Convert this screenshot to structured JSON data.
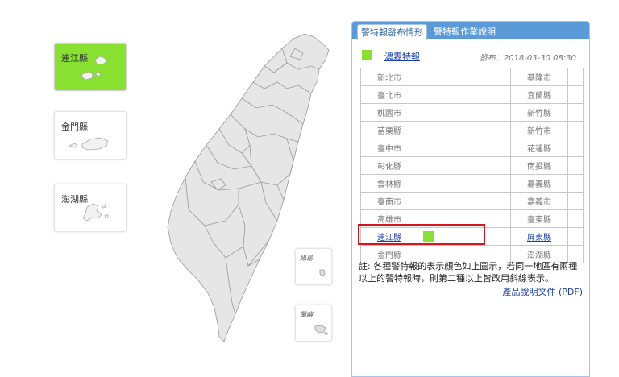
{
  "insets": {
    "lienchiang": "連江縣",
    "kinmen": "金門縣",
    "penghu": "澎湖縣",
    "green_island": "綠島",
    "orchid_island": "蘭嶼"
  },
  "panel": {
    "tabs": [
      "警特報發布情形",
      "警特報作業說明"
    ],
    "legend": {
      "label": "濃霧特報",
      "color": "#88e131"
    },
    "published": "發布：2018-03-30 08:30",
    "rows": [
      {
        "west": "新北市",
        "warn": false,
        "east": "基隆市"
      },
      {
        "west": "臺北市",
        "warn": false,
        "east": "宜蘭縣"
      },
      {
        "west": "桃園市",
        "warn": false,
        "east": "新竹縣"
      },
      {
        "west": "苗栗縣",
        "warn": false,
        "east": "新竹市"
      },
      {
        "west": "臺中市",
        "warn": false,
        "east": "花蓮縣"
      },
      {
        "west": "彰化縣",
        "warn": false,
        "east": "南投縣"
      },
      {
        "west": "雲林縣",
        "warn": false,
        "east": "嘉義縣"
      },
      {
        "west": "臺南市",
        "warn": false,
        "east": "嘉義市"
      },
      {
        "west": "高雄市",
        "warn": false,
        "east": "臺東縣"
      },
      {
        "west": "連江縣",
        "warn": true,
        "east": "屏東縣"
      },
      {
        "west": "金門縣",
        "warn": false,
        "east": "澎湖縣"
      }
    ],
    "note": "註: 各種警特報的表示顏色如上圖示，若同一地區有兩種以上的警特報時，則第二種以上皆改用斜線表示。",
    "pdf_link": "產品說明文件 (PDF)"
  }
}
